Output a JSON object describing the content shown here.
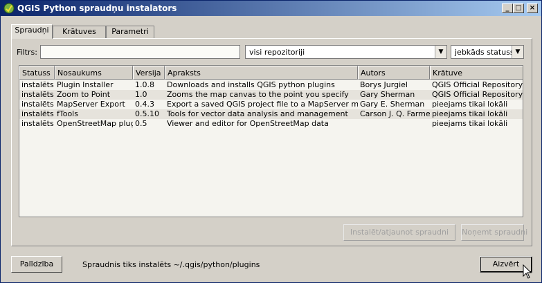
{
  "window": {
    "title": "QGIS Python spraudņu instalators"
  },
  "tabs": [
    {
      "label": "Spraudņi"
    },
    {
      "label": "Krātuves"
    },
    {
      "label": "Parametri"
    }
  ],
  "filter": {
    "label": "Filtrs:",
    "value": ""
  },
  "repo_combo": {
    "value": "visi repozitoriji"
  },
  "status_combo": {
    "value": "jebkāds statuss"
  },
  "table": {
    "headers": [
      "Statuss",
      "Nosaukums",
      "Versija",
      "Apraksts",
      "Autors",
      "Krātuve"
    ],
    "rows": [
      [
        "instalēts",
        "Plugin Installer",
        "1.0.8",
        "Downloads and installs QGIS python plugins",
        "Borys Jurgiel",
        "QGIS Official Repository"
      ],
      [
        "instalēts",
        "Zoom to Point",
        "1.0",
        "Zooms the map canvas to the point you specify",
        "Gary Sherman",
        "QGIS Official Repository"
      ],
      [
        "instalēts",
        "MapServer Export",
        "0.4.3",
        "Export a saved QGIS project file to a MapServer map file",
        "Gary E. Sherman",
        "pieejams tikai lokāli"
      ],
      [
        "instalēts",
        "fTools",
        "0.5.10",
        "Tools for vector data analysis and management",
        "Carson J. Q. Farmer",
        "pieejams tikai lokāli"
      ],
      [
        "instalēts",
        "OpenStreetMap plugin",
        "0.5",
        "Viewer and editor for OpenStreetMap data",
        "",
        "pieejams tikai lokāli"
      ]
    ]
  },
  "buttons": {
    "install": "Instalēt/atjaunot spraudni",
    "remove": "Noņemt spraudni",
    "help": "Palīdzība",
    "close": "Aizvērt"
  },
  "status_text": "Spraudnis tiks instalēts ~/.qgis/python/plugins"
}
